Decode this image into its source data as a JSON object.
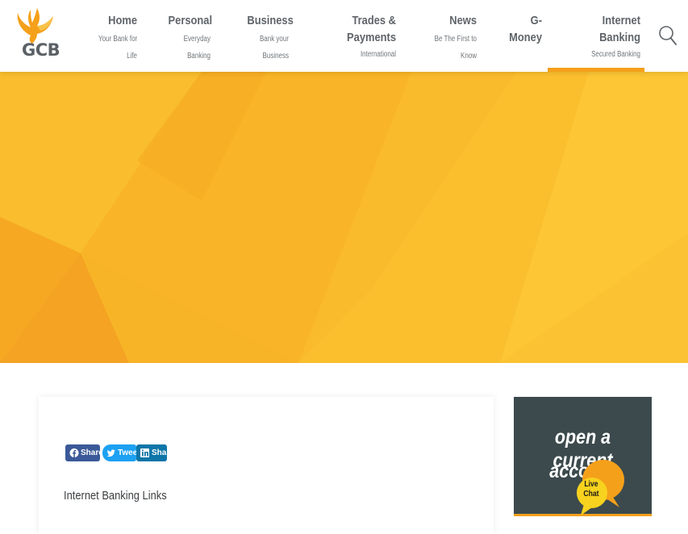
{
  "header": {
    "logo_text": "GCB",
    "nav": [
      {
        "title": "Home",
        "sub": [
          "Your Bank for",
          "Life"
        ]
      },
      {
        "title": "Personal",
        "sub": [
          "Everyday",
          "Banking"
        ]
      },
      {
        "title": "Business",
        "sub": [
          "Bank your",
          "Business"
        ]
      },
      {
        "title": [
          "Trades &",
          "Payments"
        ],
        "sub": [
          "International"
        ]
      },
      {
        "title": "News",
        "sub": [
          "Be The First to",
          "Know"
        ]
      },
      {
        "title": [
          "G-",
          "Money"
        ],
        "sub": []
      },
      {
        "title": [
          "Internet",
          "Banking"
        ],
        "sub": [
          "Secured Banking"
        ]
      }
    ],
    "active_index": 6
  },
  "content": {
    "share_buttons": {
      "facebook": "Share",
      "twitter": "Tweet",
      "linkedin": "Share"
    },
    "section_title": "Internet Banking Links"
  },
  "promo": {
    "line1": "open a current",
    "line2": "account"
  },
  "live_chat": {
    "line1": "Live",
    "line2": "Chat"
  },
  "colors": {
    "brand_yellow": "#f5a01a",
    "hero_yellow": "#f8b523",
    "nav_text": "#5f6469",
    "promo_bg": "#3c4a4d"
  }
}
